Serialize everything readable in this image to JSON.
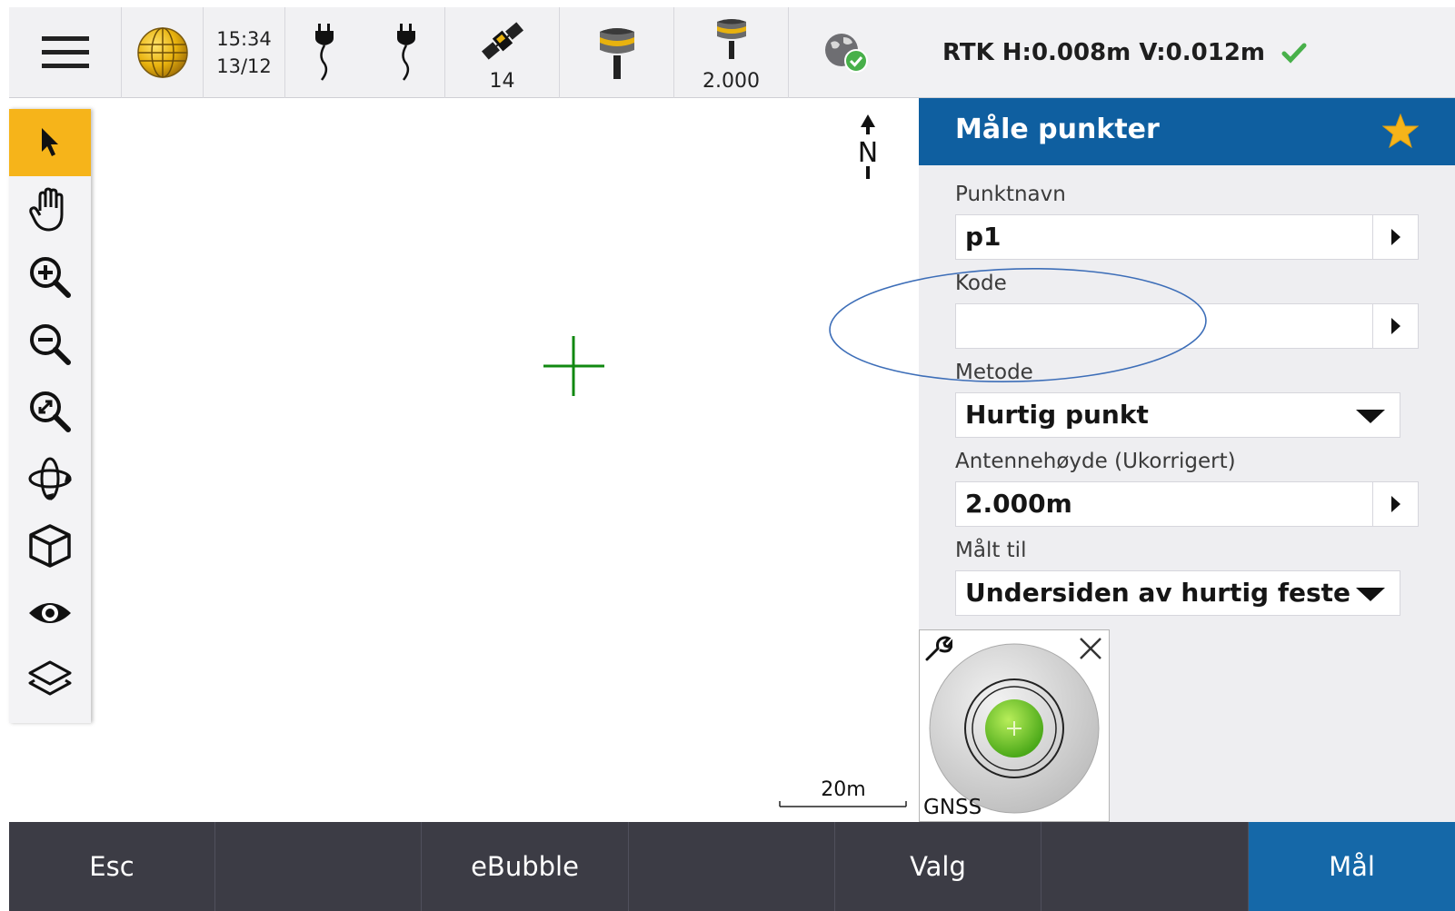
{
  "status_bar": {
    "clock_time": "15:34",
    "clock_date": "13/12",
    "satellite_count": "14",
    "antenna_height_readout": "2.000",
    "rtk_status": "RTK H:0.008m V:0.012m",
    "icons": [
      "menu-icon",
      "globe-icon",
      "power-plug-icon",
      "power-plug-icon",
      "satellite-icon",
      "gnss-receiver-icon",
      "gnss-receiver-height-icon",
      "internet-connected-icon",
      "check-icon"
    ]
  },
  "map": {
    "north_label": "N",
    "scale_label": "20m"
  },
  "left_tools": [
    "select-arrow-icon",
    "pan-hand-icon",
    "zoom-in-icon",
    "zoom-out-icon",
    "zoom-extents-icon",
    "orbit-icon",
    "cube-view-icon",
    "visibility-eye-icon",
    "layers-icon"
  ],
  "panel": {
    "title": "Måle punkter",
    "point_name_label": "Punktnavn",
    "point_name_value": "p1",
    "code_label": "Kode",
    "code_value": "",
    "method_label": "Metode",
    "method_value": "Hurtig punkt",
    "antenna_height_label": "Antennehøyde (Ukorrigert)",
    "antenna_height_value": "2.000m",
    "measured_to_label": "Målt til",
    "measured_to_value": "Undersiden av hurtig feste"
  },
  "gnss_bubble": {
    "label": "GNSS"
  },
  "softkeys": {
    "esc": "Esc",
    "ebubble": "eBubble",
    "options": "Valg",
    "measure": "Mål"
  },
  "colors": {
    "header_blue": "#0f5fa0",
    "primary_button": "#1568a8",
    "active_tool": "#f6b41a",
    "softkey_bar": "#3c3c45",
    "check_green": "#48b04a",
    "crosshair_green": "#118811",
    "bubble_green": "#6cc62a",
    "annotation_blue": "#3d6eb8"
  }
}
